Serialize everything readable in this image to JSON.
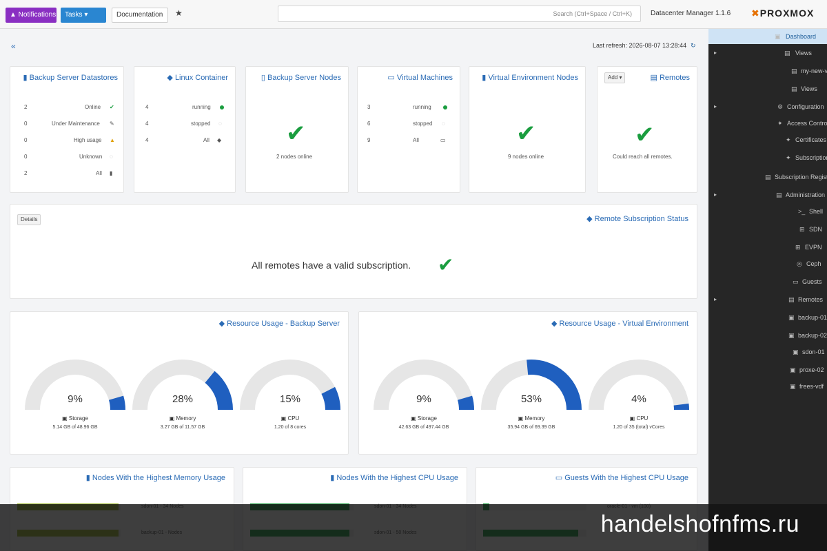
{
  "topbar": {
    "btn_purple": "▲ Notifications",
    "btn_blue": "Tasks ▾",
    "btn_docs": "Documentation",
    "star": "★",
    "search_placeholder": "Search (Ctrl+Space / Ctrl+K)",
    "app_title": "Datacenter Manager 1.1.6",
    "logo_x": "✖",
    "logo_text": "PROXMOX"
  },
  "sidebar": {
    "items": [
      {
        "label": "Dashboard",
        "icon": "▣",
        "caret": ""
      },
      {
        "label": "Views",
        "icon": "▤",
        "caret": "▸"
      },
      {
        "label": "my-new-view",
        "icon": "▤",
        "caret": ""
      },
      {
        "label": "Views",
        "icon": "▤",
        "caret": ""
      },
      {
        "label": "Configuration",
        "icon": "⚙",
        "caret": "▸"
      },
      {
        "label": "Access Control",
        "icon": "✦",
        "caret": ""
      },
      {
        "label": "Certificates",
        "icon": "✦",
        "caret": ""
      },
      {
        "label": "Subscription",
        "icon": "✦",
        "caret": ""
      },
      {
        "label": "Subscription Registry",
        "icon": "▤",
        "caret": ""
      },
      {
        "label": "Administration",
        "icon": "▤",
        "caret": "▸"
      },
      {
        "label": "Shell",
        "icon": ">_",
        "caret": ""
      },
      {
        "label": "SDN",
        "icon": "⊞",
        "caret": ""
      },
      {
        "label": "EVPN",
        "icon": "⊞",
        "caret": ""
      },
      {
        "label": "Ceph",
        "icon": "◎",
        "caret": ""
      },
      {
        "label": "Guests",
        "icon": "▭",
        "caret": ""
      },
      {
        "label": "Remotes",
        "icon": "▤",
        "caret": "▸"
      },
      {
        "label": "backup-01",
        "icon": "▣",
        "caret": ""
      },
      {
        "label": "backup-02",
        "icon": "▣",
        "caret": ""
      },
      {
        "label": "sdon-01",
        "icon": "▣",
        "caret": ""
      },
      {
        "label": "proxe-02",
        "icon": "▣",
        "caret": ""
      },
      {
        "label": "frees-vdf",
        "icon": "▣",
        "caret": ""
      }
    ]
  },
  "header": {
    "collapse_icon": "«",
    "last_refresh": "Last refresh: 2026-08-07 13:28:44"
  },
  "remotes": {
    "title": "Remotes",
    "add_label": "Add ▾",
    "caption": "Could reach all remotes."
  },
  "ve_nodes": {
    "title": "Virtual Environment Nodes",
    "caption": "9 nodes online"
  },
  "vms": {
    "title": "Virtual Machines",
    "rows": [
      {
        "label": "running",
        "count": "3"
      },
      {
        "label": "stopped",
        "count": "6"
      },
      {
        "label": "All",
        "count": "9"
      }
    ]
  },
  "pbs_nodes": {
    "title": "Backup Server Nodes",
    "caption": "2 nodes online"
  },
  "lxc": {
    "title": "Linux Container",
    "rows": [
      {
        "label": "running",
        "count": "4"
      },
      {
        "label": "stopped",
        "count": "4"
      },
      {
        "label": "All",
        "count": "4"
      }
    ]
  },
  "datastores": {
    "title": "Backup Server Datastores",
    "rows": [
      {
        "label": "Online",
        "count": "2"
      },
      {
        "label": "Under Maintenance",
        "count": "0"
      },
      {
        "label": "High usage",
        "count": "0"
      },
      {
        "label": "Unknown",
        "count": "0"
      },
      {
        "label": "All",
        "count": "2"
      }
    ]
  },
  "subscription": {
    "title": "Remote Subscription Status",
    "details_label": "Details",
    "message": "All remotes have a valid subscription."
  },
  "usage_ve": {
    "title": "Resource Usage - Virtual Environment",
    "gauges": [
      {
        "value": "4%",
        "fraction": 0.04,
        "label": "CPU",
        "sub": "1.20 of 35 (total) vCores"
      },
      {
        "value": "53%",
        "fraction": 0.53,
        "label": "Memory",
        "sub": "35.94 GB of 69.39 GB"
      },
      {
        "value": "9%",
        "fraction": 0.09,
        "label": "Storage",
        "sub": "42.63 GB of 497.44 GB"
      }
    ]
  },
  "usage_pbs": {
    "title": "Resource Usage - Backup Server",
    "gauges": [
      {
        "value": "15%",
        "fraction": 0.15,
        "label": "CPU",
        "sub": "1.20 of 8 cores"
      },
      {
        "value": "28%",
        "fraction": 0.28,
        "label": "Memory",
        "sub": "3.27 GB of 11.57 GB"
      },
      {
        "value": "9%",
        "fraction": 0.09,
        "label": "Storage",
        "sub": "5.14 GB of 48.96 GB"
      }
    ]
  },
  "top_guests_cpu": {
    "title": "Guests With the Highest CPU Usage",
    "rows": [
      {
        "label": "oracle-01 - vm (100)",
        "fraction": 0.06,
        "color": "#1a9d3f"
      },
      {
        "label": "",
        "fraction": 0.92,
        "color": "#1a9d3f"
      }
    ]
  },
  "top_nodes_cpu": {
    "title": "Nodes With the Highest CPU Usage",
    "rows": [
      {
        "label": "sdon-01 - 34 Nodes",
        "fraction": 0.96,
        "color": "#1a9d3f"
      },
      {
        "label": "sdon-01 - 50 Nodes",
        "fraction": 0.96,
        "color": "#1a9d3f"
      }
    ]
  },
  "top_nodes_mem": {
    "title": "Nodes With the Highest Memory Usage",
    "rows": [
      {
        "label": "sdon-01 - 34 Nodes",
        "fraction": 0.98,
        "color": "#9ab52a"
      },
      {
        "label": "backup-01 - Nodes",
        "fraction": 0.98,
        "color": "#9ab52a"
      }
    ]
  },
  "watermark": "handelshofnfms.ru",
  "colors": {
    "accent": "#2a6bb5",
    "ok": "#1a9d3f",
    "gauge_fill": "#1f5fbf",
    "gauge_track": "#e6e6e6",
    "sidebar": "#262626"
  }
}
